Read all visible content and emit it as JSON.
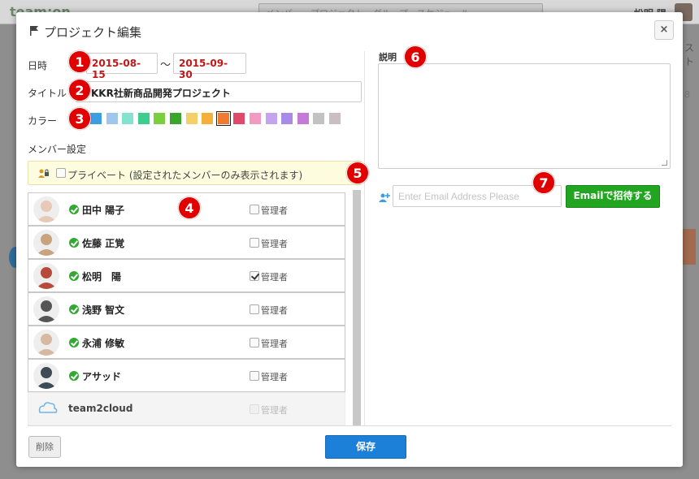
{
  "background": {
    "logo": "team:on",
    "search_placeholder": "メンバー、プロジェクト、グループ、スケジュール",
    "user_text": "松明 陽",
    "right_edge_text": "スト",
    "right_edge_num": "8"
  },
  "modal": {
    "title": "プロジェクト編集",
    "close_label": "×",
    "date_label": "日時",
    "start_date": "2015-08-15",
    "tilde": "～",
    "end_date": "2015-09-30",
    "title_label": "タイトル",
    "title_value": "KKR社新商品開発プロジェクト",
    "color_label": "カラー",
    "colors": [
      "#3a9ee0",
      "#9fc7ee",
      "#84e2cf",
      "#3fcc8f",
      "#7bcf3f",
      "#3aa52d",
      "#f4d06b",
      "#f4b03a",
      "#f07a30",
      "#e04a6a",
      "#f29ac1",
      "#c4a4ee",
      "#a88be6",
      "#c67ad8",
      "#c2c2c2",
      "#cbbdc4"
    ],
    "selected_color_index": 8,
    "member_section_label": "メンバー設定",
    "private_label": "プライベート (設定されたメンバーのみ表示されます)",
    "description_label": "説明",
    "description_value": "",
    "email_placeholder": "Enter Email Address Please",
    "invite_button": "Emailで招待する",
    "delete_button": "削除",
    "save_button": "保存"
  },
  "members": [
    {
      "name": "田中 陽子",
      "admin_label": "管理者",
      "admin": false,
      "active": true
    },
    {
      "name": "佐藤 正覚",
      "admin_label": "管理者",
      "admin": false,
      "active": true
    },
    {
      "name": "松明　陽",
      "admin_label": "管理者",
      "admin": true,
      "active": true
    },
    {
      "name": "浅野 智文",
      "admin_label": "管理者",
      "admin": false,
      "active": true
    },
    {
      "name": "永浦 修敏",
      "admin_label": "管理者",
      "admin": false,
      "active": true
    },
    {
      "name": "アサッド",
      "admin_label": "管理者",
      "admin": false,
      "active": true
    },
    {
      "name": "team2cloud",
      "admin_label": "管理者",
      "admin": false,
      "active": false
    }
  ],
  "annotations": [
    "1",
    "2",
    "3",
    "4",
    "5",
    "6",
    "7"
  ]
}
